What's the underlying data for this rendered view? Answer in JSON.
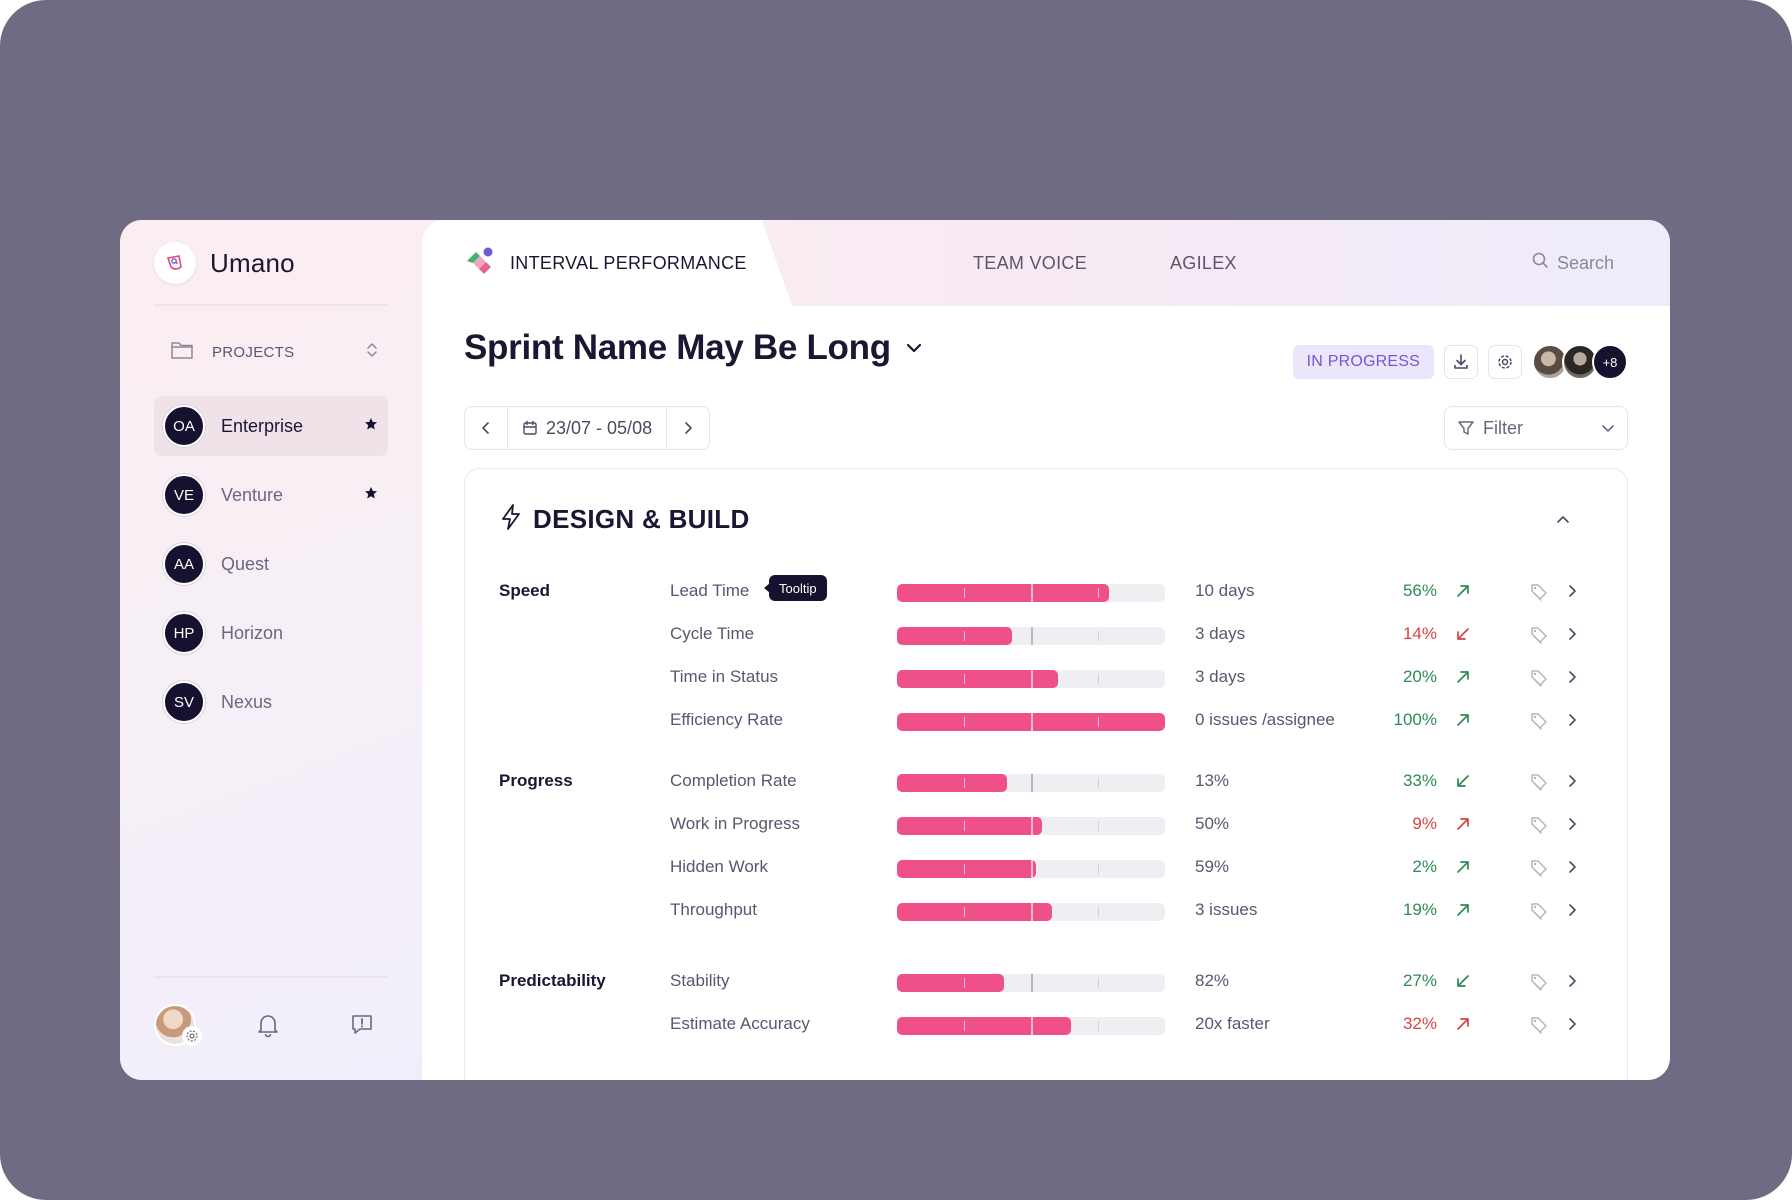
{
  "brand": {
    "name": "Umano"
  },
  "sidebar": {
    "projects_label": "PROJECTS",
    "items": [
      {
        "initials": "OA",
        "name": "Enterprise",
        "starred": true,
        "active": true
      },
      {
        "initials": "VE",
        "name": "Venture",
        "starred": true,
        "active": false
      },
      {
        "initials": "AA",
        "name": "Quest",
        "starred": false,
        "active": false
      },
      {
        "initials": "HP",
        "name": "Horizon",
        "starred": false,
        "active": false
      },
      {
        "initials": "SV",
        "name": "Nexus",
        "starred": false,
        "active": false
      }
    ]
  },
  "tabs": [
    {
      "label": "INTERVAL PERFORMANCE",
      "active": true
    },
    {
      "label": "TEAM VOICE",
      "active": false
    },
    {
      "label": "AGILEX",
      "active": false
    }
  ],
  "search": {
    "label": "Search"
  },
  "page": {
    "title": "Sprint Name May Be Long",
    "status": "IN PROGRESS",
    "extra_members": "+8",
    "date_range": "23/07 - 05/08",
    "filter_label": "Filter"
  },
  "card": {
    "title": "DESIGN & BUILD",
    "tooltip": "Tooltip",
    "groups": [
      {
        "label": "Speed",
        "metrics": [
          {
            "name": "Lead Time",
            "value": "10 days",
            "pct": "56%",
            "trend": "up",
            "status": "good",
            "fill": 0.79
          },
          {
            "name": "Cycle Time",
            "value": "3 days",
            "pct": "14%",
            "trend": "down",
            "status": "bad",
            "fill": 0.43
          },
          {
            "name": "Time in Status",
            "value": "3 days",
            "pct": "20%",
            "trend": "up",
            "status": "good",
            "fill": 0.6
          },
          {
            "name": "Efficiency Rate",
            "value": "0 issues /assignee",
            "pct": "100%",
            "trend": "up",
            "status": "good",
            "fill": 1.0
          }
        ]
      },
      {
        "label": "Progress",
        "metrics": [
          {
            "name": "Completion Rate",
            "value": "13%",
            "pct": "33%",
            "trend": "down",
            "status": "good",
            "fill": 0.41
          },
          {
            "name": "Work in Progress",
            "value": "50%",
            "pct": "9%",
            "trend": "up",
            "status": "bad",
            "fill": 0.54
          },
          {
            "name": "Hidden Work",
            "value": "59%",
            "pct": "2%",
            "trend": "up",
            "status": "good",
            "fill": 0.52
          },
          {
            "name": "Throughput",
            "value": "3 issues",
            "pct": "19%",
            "trend": "up",
            "status": "good",
            "fill": 0.58
          }
        ]
      },
      {
        "label": "Predictability",
        "metrics": [
          {
            "name": "Stability",
            "value": "82%",
            "pct": "27%",
            "trend": "down",
            "status": "good",
            "fill": 0.4
          },
          {
            "name": "Estimate Accuracy",
            "value": "20x faster",
            "pct": "32%",
            "trend": "up",
            "status": "bad",
            "fill": 0.65
          }
        ]
      }
    ]
  },
  "colors": {
    "accent_bar": "#f0508a",
    "good": "#2f8a55",
    "bad": "#d64545",
    "dark": "#15112e"
  }
}
